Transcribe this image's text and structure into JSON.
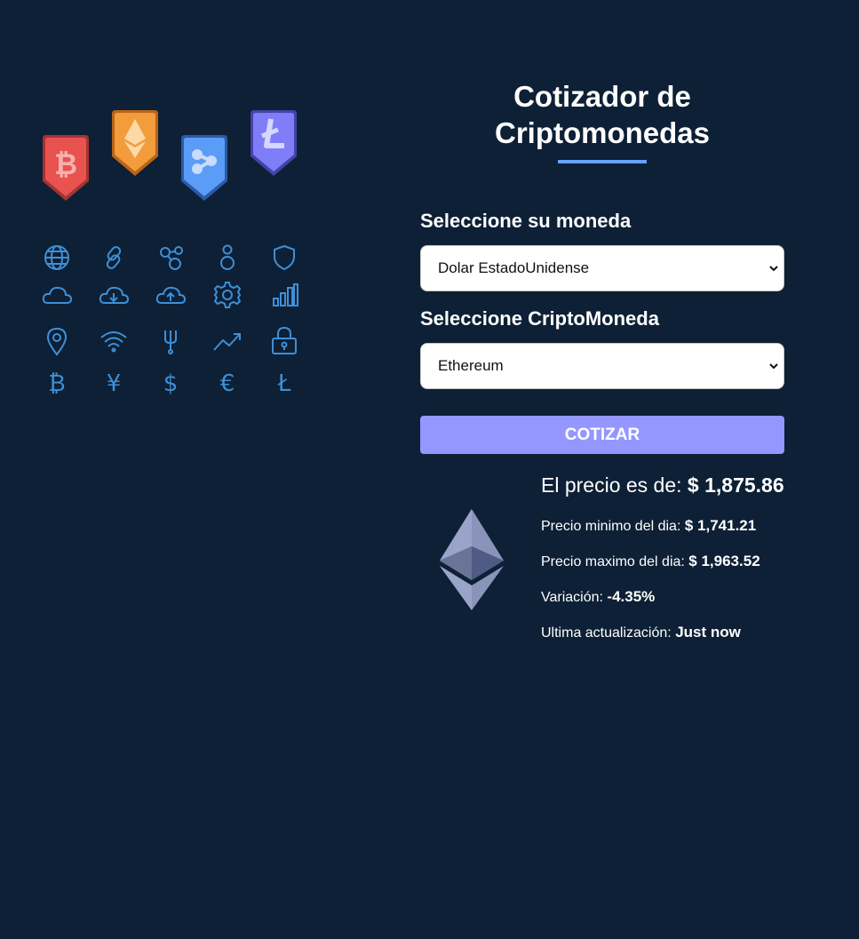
{
  "app": {
    "title": "Cotizador de Criptomonedas"
  },
  "form": {
    "currency_label": "Seleccione su moneda",
    "currency_selected": "Dolar EstadoUnidense",
    "crypto_label": "Seleccione CriptoMoneda",
    "crypto_selected": "Ethereum",
    "submit_label": "COTIZAR"
  },
  "result": {
    "price_label": "El precio es de:",
    "price_value": "$ 1,875.86",
    "min_label": "Precio minimo del dia:",
    "min_value": "$ 1,741.21",
    "max_label": "Precio maximo del dia:",
    "max_value": "$ 1,963.52",
    "change_label": "Variación:",
    "change_value": "-4.35%",
    "updated_label": "Ultima actualización:",
    "updated_value": "Just now",
    "coin_icon": "ethereum-logo-icon"
  },
  "colors": {
    "background": "#0d2035",
    "accent_line": "#66a2fe",
    "button": "#9497ff",
    "bitcoin_badge": "#e8534f",
    "ethereum_badge": "#f39c3c",
    "ripple_badge": "#5b9cf6",
    "litecoin_badge": "#7f7ef8",
    "line_icons": "#3f8fd6"
  },
  "illustration": {
    "badges": [
      "bitcoin-badge-icon",
      "ethereum-badge-icon",
      "ripple-badge-icon",
      "litecoin-badge-icon"
    ],
    "icons": [
      "globe-icon",
      "link-icon",
      "network-icon",
      "user-icon",
      "shield-icon",
      "cloud-icon",
      "cloud-download-icon",
      "cloud-upload-icon",
      "gear-icon",
      "bar-chart-icon",
      "location-pin-icon",
      "wifi-icon",
      "fork-icon",
      "trend-up-icon",
      "lock-icon",
      "bitcoin-icon",
      "yen-icon",
      "dollar-icon",
      "euro-icon",
      "litecoin-icon"
    ]
  }
}
